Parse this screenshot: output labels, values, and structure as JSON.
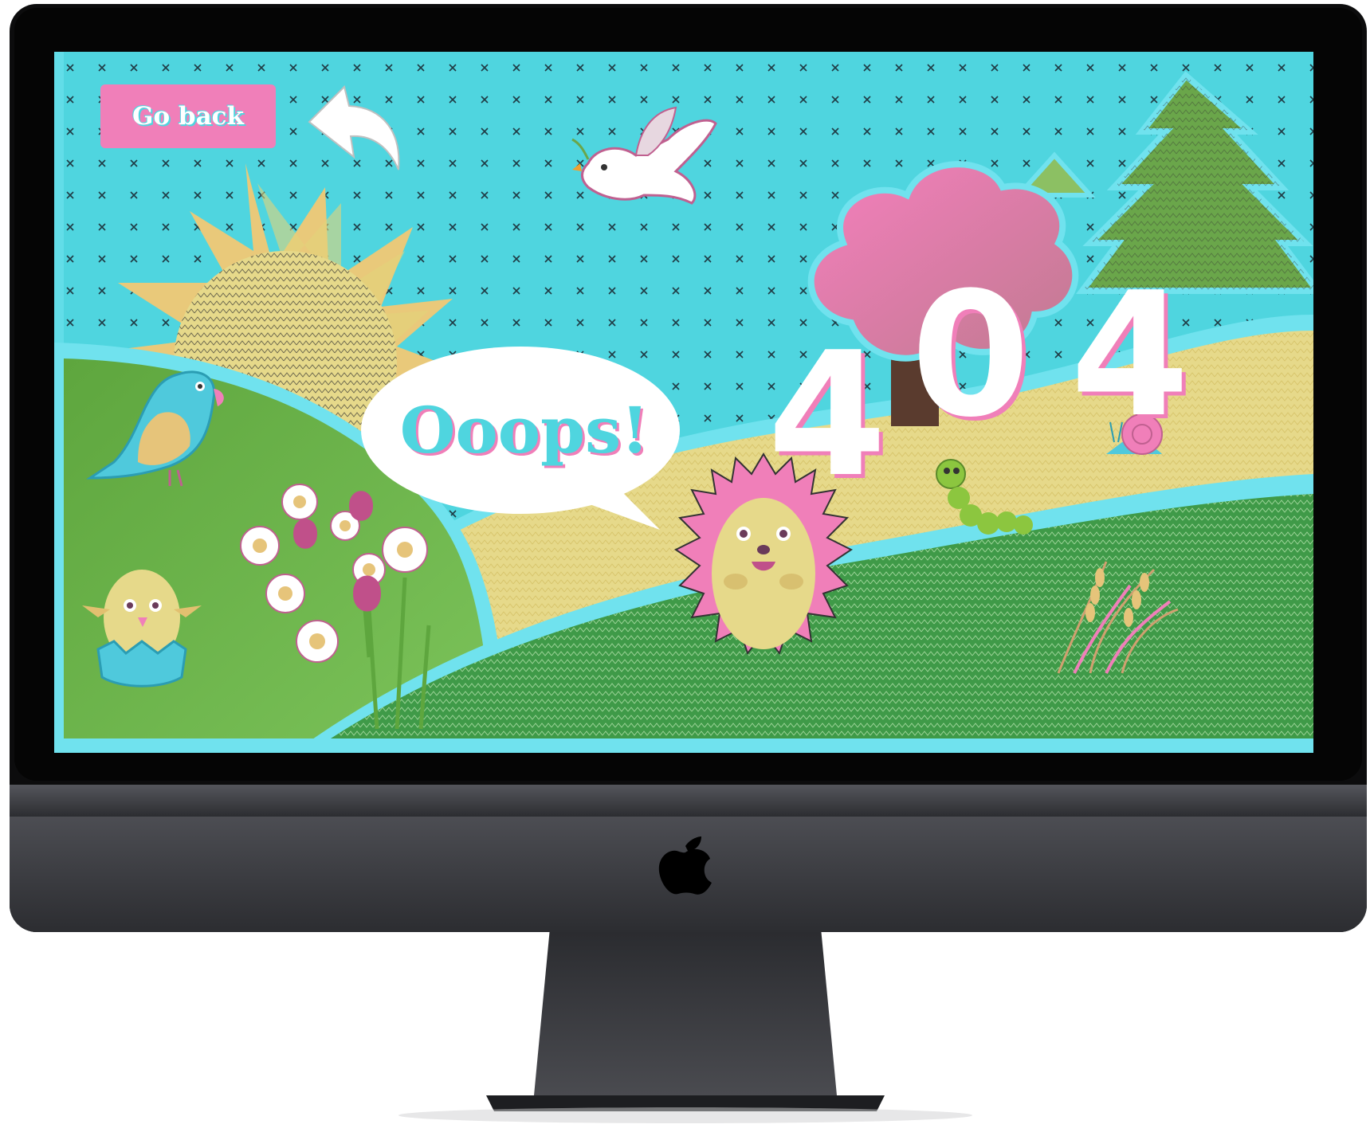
{
  "page": {
    "go_back_label": "Go back",
    "speech_bubble_text": "Ooops!",
    "error_code_digits": [
      "4",
      "0",
      "4"
    ]
  },
  "colors": {
    "sky": "#4fd5df",
    "pink": "#f07fb9",
    "grass_light": "#6fb84a",
    "grass_dark": "#3f9a48",
    "sand": "#e6d98a",
    "sun": "#e9c97a",
    "tree": "#6aa64a",
    "bezel": "#111111",
    "chin": "#3a3b40"
  },
  "icons": [
    "back-arrow-icon",
    "dove-icon",
    "sun-icon",
    "bird-icon",
    "chick-icon",
    "flowers-icon",
    "hedgehog-icon",
    "caterpillar-icon",
    "snail-icon",
    "wheat-icon",
    "pink-tree-icon",
    "pine-tree-icon",
    "apple-logo-icon"
  ]
}
